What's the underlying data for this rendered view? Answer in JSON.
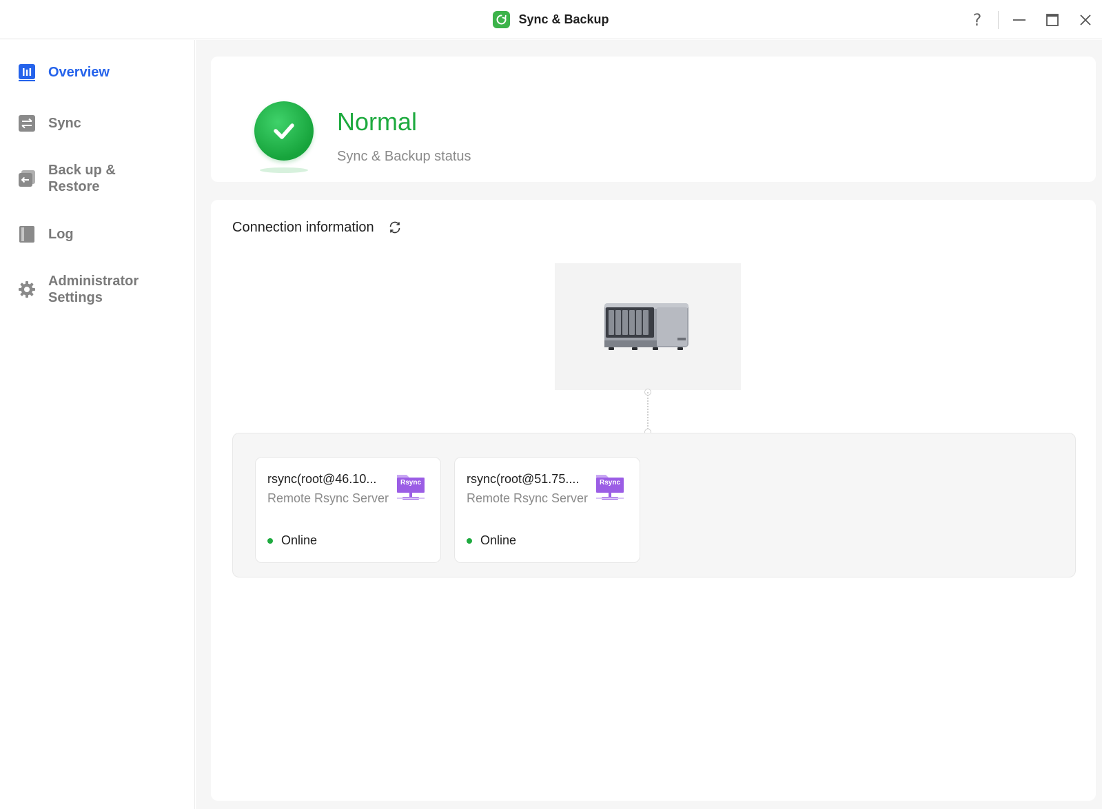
{
  "window": {
    "title": "Sync & Backup",
    "controls": [
      "help-icon",
      "minimize-icon",
      "maximize-icon",
      "close-icon"
    ]
  },
  "colors": {
    "accent": "#2563eb",
    "success": "#1eaa3f",
    "rsync": "#9b5de5",
    "app_logo": "#3cb34a"
  },
  "sidebar": {
    "items": [
      {
        "label": "Overview",
        "icon": "overview-chart-icon",
        "active": true
      },
      {
        "label": "Sync",
        "icon": "sync-arrows-icon",
        "active": false
      },
      {
        "label": "Back up & Restore",
        "icon": "backup-restore-icon",
        "active": false
      },
      {
        "label": "Log",
        "icon": "log-book-icon",
        "active": false
      },
      {
        "label": "Administrator Settings",
        "icon": "gear-icon",
        "active": false
      }
    ]
  },
  "status": {
    "title": "Normal",
    "subtitle": "Sync & Backup status",
    "icon": "check-circle-icon"
  },
  "connection": {
    "title": "Connection information",
    "refresh_icon": "refresh-icon",
    "device_icon": "nas-device-icon",
    "targets": [
      {
        "name": "rsync(root@46.10...",
        "type": "Remote Rsync Server",
        "icon_label": "Rsync",
        "status": "Online"
      },
      {
        "name": "rsync(root@51.75....",
        "type": "Remote Rsync Server",
        "icon_label": "Rsync",
        "status": "Online"
      }
    ]
  }
}
